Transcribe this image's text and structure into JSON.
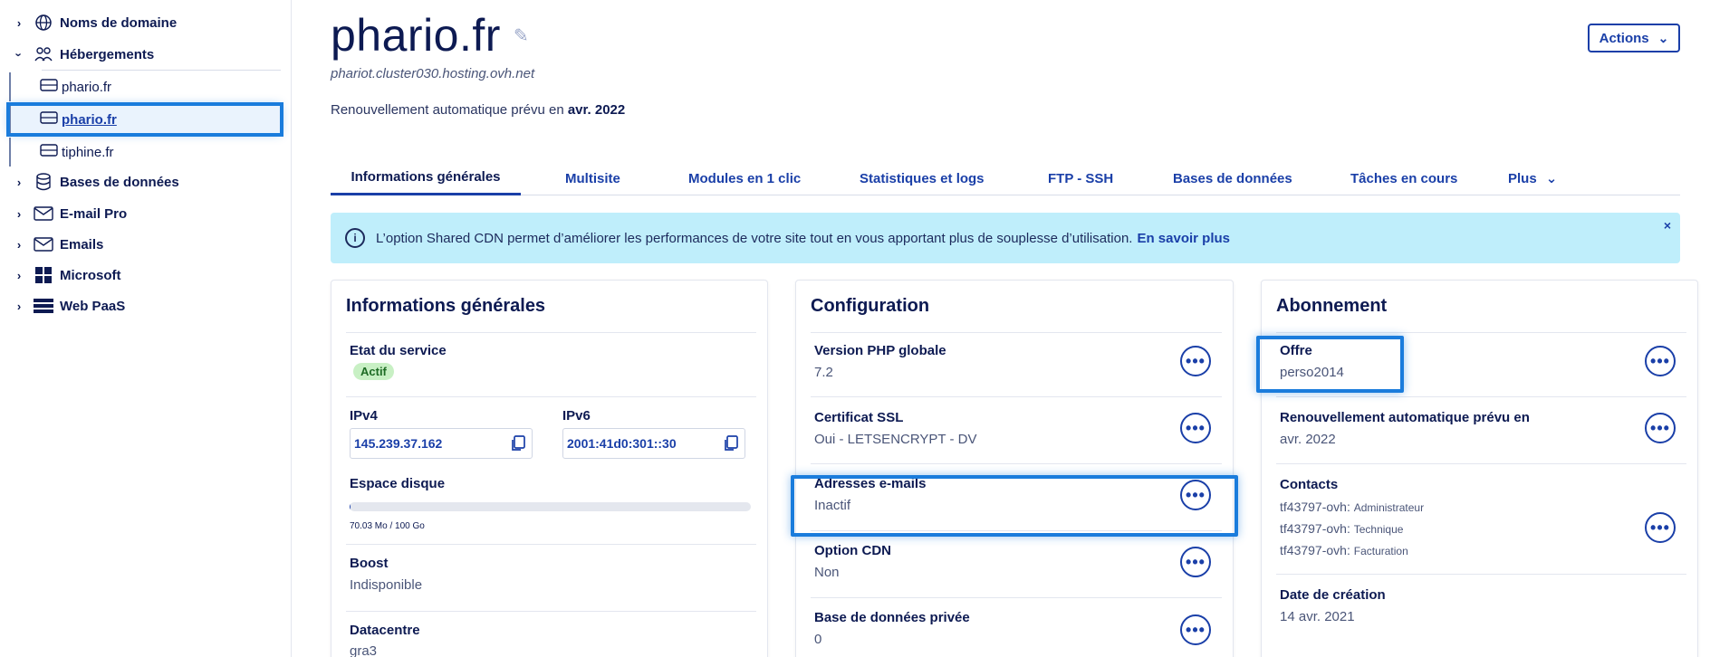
{
  "sidebar": {
    "items": [
      {
        "label": "Noms de domaine",
        "icon": "globe-icon",
        "expanded": false
      },
      {
        "label": "Hébergements",
        "icon": "hosting-icon",
        "expanded": true
      },
      {
        "label": "Bases de données",
        "icon": "database-icon",
        "expanded": false
      },
      {
        "label": "E-mail Pro",
        "icon": "envelope-icon",
        "expanded": false
      },
      {
        "label": "Emails",
        "icon": "envelope-icon",
        "expanded": false
      },
      {
        "label": "Microsoft",
        "icon": "windows-icon",
        "expanded": false
      },
      {
        "label": "Web PaaS",
        "icon": "stack-icon",
        "expanded": false
      }
    ],
    "hosting_children": [
      {
        "label": "phario.fr",
        "active": false
      },
      {
        "label": "phario.fr",
        "active": true
      },
      {
        "label": "tiphine.fr",
        "active": false
      }
    ]
  },
  "header": {
    "title": "phario.fr",
    "subtitle": "phariot.cluster030.hosting.ovh.net",
    "renew_prefix": "Renouvellement automatique prévu en",
    "renew_date": "avr. 2022",
    "actions_label": "Actions"
  },
  "tabs": [
    {
      "label": "Informations générales",
      "active": true
    },
    {
      "label": "Multisite",
      "active": false
    },
    {
      "label": "Modules en 1 clic",
      "active": false
    },
    {
      "label": "Statistiques et logs",
      "active": false
    },
    {
      "label": "FTP - SSH",
      "active": false
    },
    {
      "label": "Bases de données",
      "active": false
    },
    {
      "label": "Tâches en cours",
      "active": false
    },
    {
      "label": "Plus",
      "active": false
    }
  ],
  "banner": {
    "text": "L’option Shared CDN permet d’améliorer les performances de votre site tout en vous apportant plus de souplesse d’utilisation.",
    "link": "En savoir plus",
    "close": "×"
  },
  "general": {
    "title": "Informations générales",
    "service_state_label": "Etat du service",
    "service_state_value": "Actif",
    "ipv4_label": "IPv4",
    "ipv4_value": "145.239.37.162",
    "ipv6_label": "IPv6",
    "ipv6_value": "2001:41d0:301::30",
    "disk_label": "Espace disque",
    "disk_usage_text": "70.03 Mo / 100 Go",
    "disk_fraction": 0.0007,
    "boost_label": "Boost",
    "boost_value": "Indisponible",
    "datacenter_label": "Datacentre",
    "datacenter_value": "gra3"
  },
  "configuration": {
    "title": "Configuration",
    "php_label": "Version PHP globale",
    "php_value": "7.2",
    "ssl_label": "Certificat SSL",
    "ssl_value": "Oui - LETSENCRYPT - DV",
    "emails_label": "Adresses e-mails",
    "emails_value": "Inactif",
    "cdn_label": "Option CDN",
    "cdn_value": "Non",
    "privdb_label": "Base de données privée",
    "privdb_value": "0"
  },
  "subscription": {
    "title": "Abonnement",
    "offer_label": "Offre",
    "offer_value": "perso2014",
    "renew_label": "Renouvellement automatique prévu en",
    "renew_value": "avr. 2022",
    "contacts_label": "Contacts",
    "contacts": [
      {
        "id": "tf43797-ovh:",
        "role": "Administrateur"
      },
      {
        "id": "tf43797-ovh:",
        "role": "Technique"
      },
      {
        "id": "tf43797-ovh:",
        "role": "Facturation"
      }
    ],
    "creation_label": "Date de création",
    "creation_value": "14 avr. 2021"
  },
  "colors": {
    "primary": "#1a3fa8",
    "text": "#0d1a52",
    "banner_bg": "#bfeefb",
    "highlight": "#1a7cdc",
    "active_badge": "#c8f0c4"
  }
}
